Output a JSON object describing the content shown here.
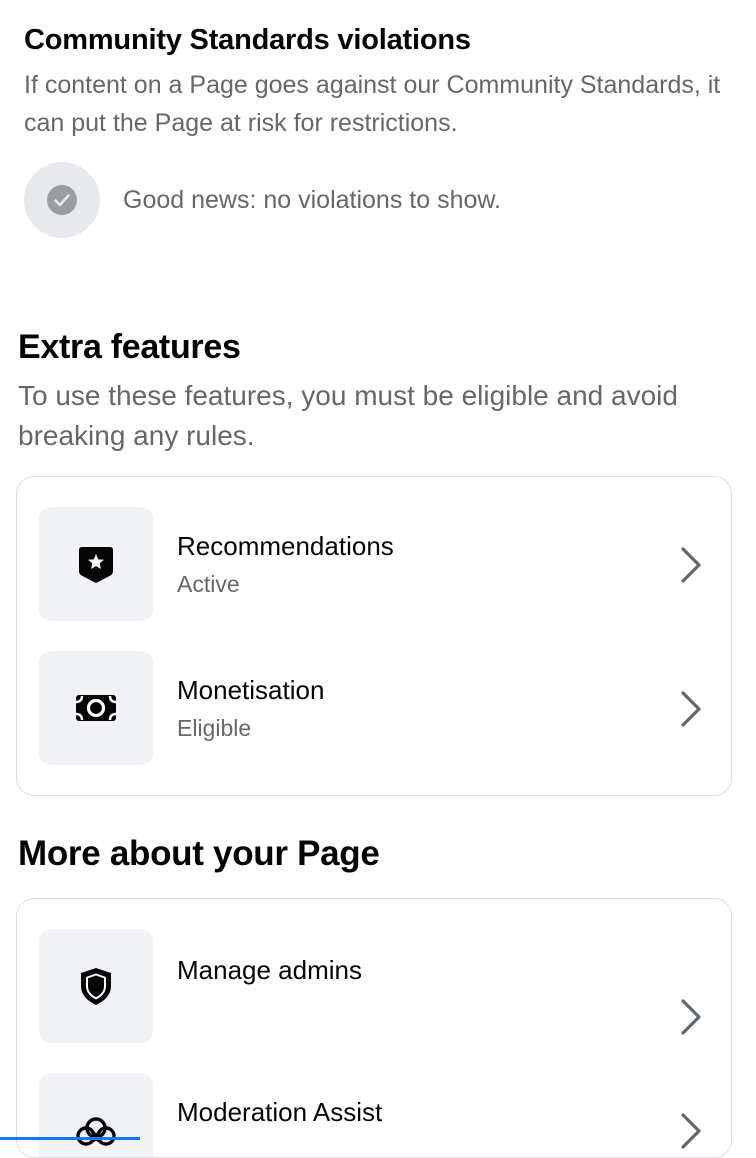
{
  "community_standards": {
    "title": "Community Standards violations",
    "description": "If content on a Page goes against our Community Standards, it can put the Page at risk for restrictions.",
    "status_text": "Good news: no violations to show.",
    "status_icon": "check-circle-icon"
  },
  "extra_features": {
    "title": "Extra features",
    "description": "To use these features, you must be eligible and avoid breaking any rules.",
    "items": [
      {
        "label": "Recommendations",
        "status": "Active",
        "icon": "shield-star-icon"
      },
      {
        "label": "Monetisation",
        "status": "Eligible",
        "icon": "money-icon"
      }
    ]
  },
  "more_about_page": {
    "title": "More about your Page",
    "items": [
      {
        "label": "Manage admins",
        "icon": "shield-icon"
      },
      {
        "label": "Moderation Assist",
        "icon": "moderation-assist-icon"
      }
    ]
  },
  "colors": {
    "primary_text": "#050505",
    "secondary_text": "#65676b",
    "tile_background": "#f0f2f5",
    "card_border": "#dadde1",
    "accent": "#1877f2"
  }
}
